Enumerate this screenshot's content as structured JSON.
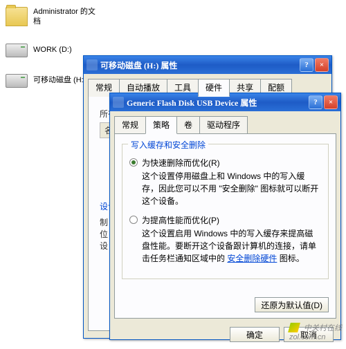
{
  "desktop": {
    "folder_label": "Administrator 的文\n档",
    "drive1_label": "WORK (D:)",
    "drive2_label": "可移动磁盘 (H:)"
  },
  "back_window": {
    "title": "可移动磁盘 (H:) 属性",
    "tabs": [
      "常规",
      "自动播放",
      "工具",
      "硬件",
      "共享",
      "配额"
    ],
    "active_tab": 3,
    "all_label": "所有",
    "col_name": "名称",
    "side_labels": {
      "dev": "设计",
      "brand": "制",
      "loc": "位",
      "state": "设"
    }
  },
  "front_window": {
    "title": "Generic Flash Disk USB Device 属性",
    "tabs": [
      "常规",
      "策略",
      "卷",
      "驱动程序"
    ],
    "active_tab": 1,
    "group_title": "写入缓存和安全删除",
    "opt1_label": "为快速删除而优化(R)",
    "opt1_desc": "这个设置停用磁盘上和 Windows 中的写入缓存，因此您可以不用 \"安全删除\" 图标就可以断开这个设备。",
    "opt2_label": "为提高性能而优化(P)",
    "opt2_desc_a": "这个设置启用 Windows 中的写入缓存来提高磁盘性能。要断开这个设备跟计算机的连接，请单击任务栏通知区域中的",
    "opt2_link": "安全删除硬件",
    "opt2_desc_b": "图标。",
    "restore_btn": "还原为默认值(D)",
    "ok_btn": "确定",
    "cancel_btn": "取消"
  },
  "watermark": {
    "site": "zol.com.cn",
    "brand": "中关村在线"
  }
}
